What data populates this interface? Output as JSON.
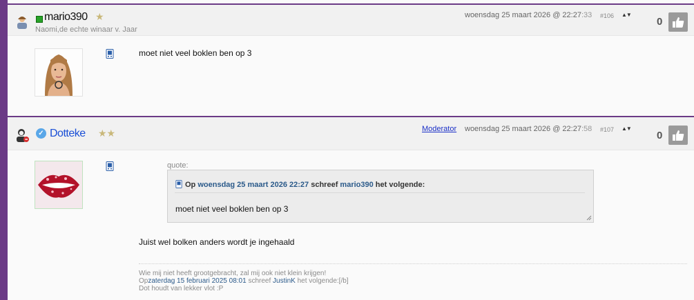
{
  "posts": [
    {
      "username": "mario390",
      "subtitle": "Naomi,de echte winaar v. Jaar",
      "date_main": "woensdag 25 maart 2026 @ 22:27",
      "date_secs": ":33",
      "post_number": "#106",
      "arrows": "▲▼",
      "votes": "0",
      "text": "moet niet veel boklen ben op 3",
      "icons": {
        "rank": "user-icon",
        "online": "online-status-icon",
        "star": "star-icon",
        "device": "mobile-device-icon",
        "like": "thumbs-up-icon"
      }
    },
    {
      "username": "Dotteke",
      "role": "Moderator",
      "date_main": "woensdag 25 maart 2026 @ 22:27",
      "date_secs": ":58",
      "post_number": "#107",
      "arrows": "▲▼",
      "votes": "0",
      "quote": {
        "label": "quote:",
        "prefix": "Op",
        "date": "woensdag 25 maart 2026 22:27",
        "wrote": "schreef",
        "user": "mario390",
        "suffix": "het volgende:",
        "body": "moet niet veel boklen ben op 3"
      },
      "text": "Juist wel bolken anders wordt je ingehaald",
      "signature": {
        "line1": "Wie mij niet heeft grootgebracht, zal mij ook niet klein krijgen!",
        "line2_prefix": "Op",
        "line2_date": "zaterdag 15 februari 2025 08:01",
        "line2_wrote": "schreef",
        "line2_user": "JustinK",
        "line2_suffix": "het volgende:[/b]",
        "line3": "Dot houdt van lekker vlot :P"
      },
      "icons": {
        "rank": "moderator-icon",
        "verified": "verified-check-icon",
        "star": "double-star-icon",
        "device": "mobile-device-icon",
        "like": "thumbs-up-icon"
      }
    }
  ],
  "colors": {
    "accent": "#6b3a86",
    "link": "#2b5a8a",
    "moderator": "#1a2fc7"
  }
}
